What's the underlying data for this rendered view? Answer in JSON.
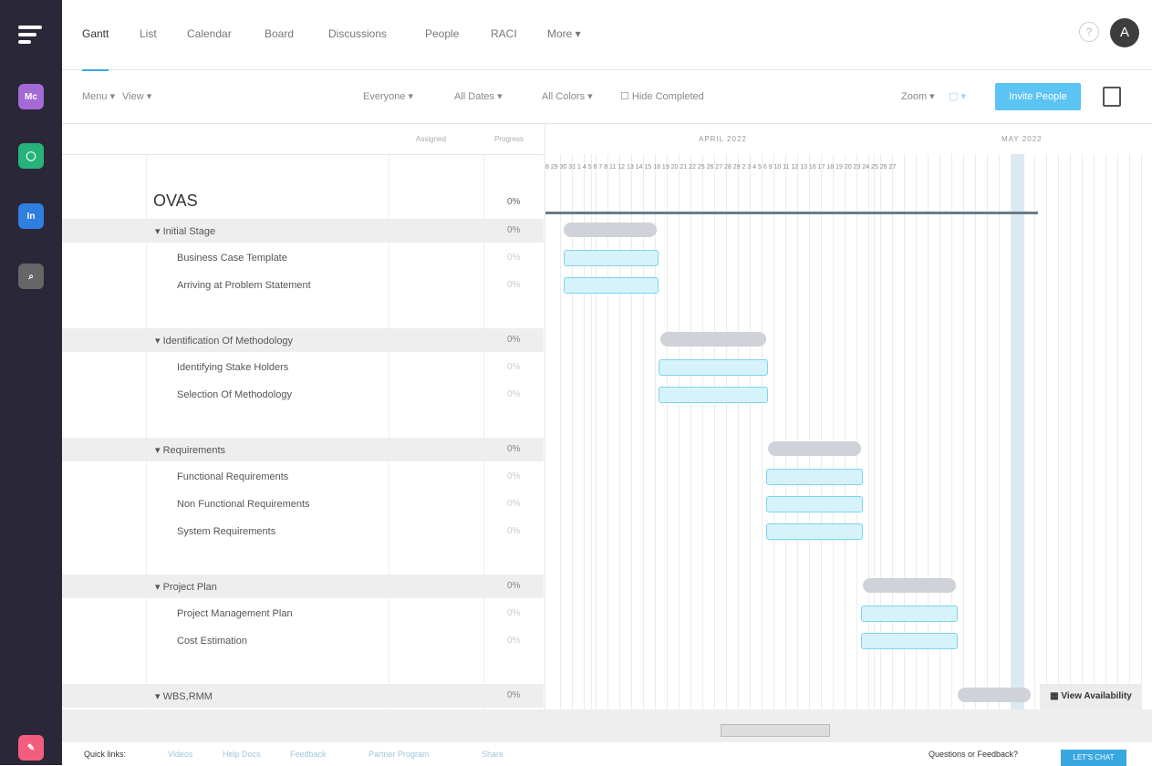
{
  "nav_tabs": [
    "Gantt",
    "List",
    "Calendar",
    "Board",
    "Discussions",
    "People",
    "RACI",
    "More ▾"
  ],
  "avatar_initial": "A",
  "toolbar": {
    "menu": "Menu ▾",
    "view": "View ▾",
    "everyone": "Everyone ▾",
    "all_dates": "All Dates ▾",
    "all_colors": "All Colors ▾",
    "hide_completed": "☐ Hide Completed",
    "zoom": "Zoom ▾",
    "invite": "Invite People"
  },
  "columns": {
    "assigned": "Assigned",
    "progress": "Progress"
  },
  "months": [
    "APRIL 2022",
    "MAY 2022"
  ],
  "days": "8 29 30 31 1 4 5 6 7 8 11 12 13 14 15 18 19 20 21 22 25 26 27 28 29 2 3 4 5 6 9 10 11 12 13 16 17 18 19 20 23 24 25 26 27",
  "project": {
    "title": "OVAS",
    "progress": "0%"
  },
  "rows": [
    {
      "type": "group",
      "name": "▾ Initial Stage",
      "progress": "0%"
    },
    {
      "type": "task",
      "name": "Business Case Template",
      "progress": "0%"
    },
    {
      "type": "task",
      "name": "Arriving at Problem Statement",
      "progress": "0%"
    },
    {
      "type": "group",
      "name": "▾ Identification Of Methodology",
      "progress": "0%"
    },
    {
      "type": "task",
      "name": "Identifying Stake Holders",
      "progress": "0%"
    },
    {
      "type": "task",
      "name": "Selection Of Methodology",
      "progress": "0%"
    },
    {
      "type": "group",
      "name": "▾ Requirements",
      "progress": "0%"
    },
    {
      "type": "task",
      "name": "Functional Requirements",
      "progress": "0%"
    },
    {
      "type": "task",
      "name": "Non Functional Requirements",
      "progress": "0%"
    },
    {
      "type": "task",
      "name": "System Requirements",
      "progress": "0%"
    },
    {
      "type": "group",
      "name": "▾ Project Plan",
      "progress": "0%"
    },
    {
      "type": "task",
      "name": "Project Management Plan",
      "progress": "0%"
    },
    {
      "type": "task",
      "name": "Cost Estimation",
      "progress": "0%"
    },
    {
      "type": "group",
      "name": "▾ WBS,RMM",
      "progress": "0%"
    }
  ],
  "view_availability": "View Availability",
  "footer": {
    "quick_links": "Quick links:",
    "links": [
      "Videos",
      "Help Docs",
      "Feedback",
      "Partner Program",
      "Share"
    ],
    "question": "Questions or Feedback?",
    "cta": "LET'S CHAT"
  },
  "colors": {
    "rail": "#2a2738",
    "accent": "#39a8e0",
    "task_bar": "#d6f3fb",
    "group_bar": "#cfd2d8"
  },
  "icons": [
    "logo-icon",
    "mc-app-icon",
    "chat-app-icon",
    "in-app-icon",
    "search-app-icon",
    "help-icon",
    "copy-icon",
    "calendar-icon",
    "rocket-icon"
  ]
}
